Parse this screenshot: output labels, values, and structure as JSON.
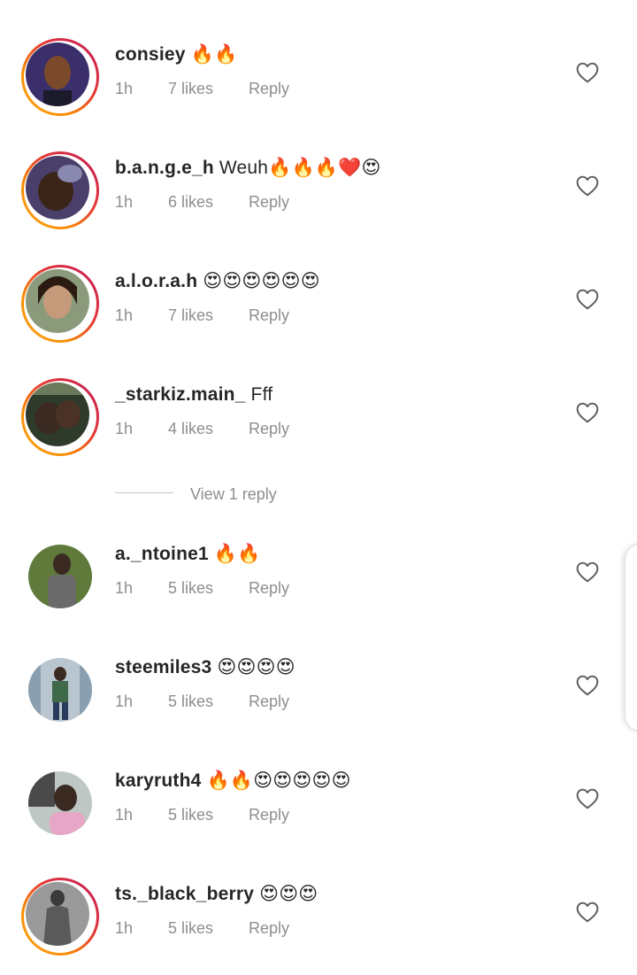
{
  "comments": [
    {
      "username": "consiey",
      "text": "🔥🔥",
      "time": "1h",
      "likes": "7 likes",
      "reply": "Reply",
      "story_ring": true,
      "avatar_bg": "#3a2f6b",
      "avatar_fg": "#7a4a2a"
    },
    {
      "username": "b.a.n.g.e_h",
      "text": "Weuh🔥🔥🔥❤️😍",
      "time": "1h",
      "likes": "6 likes",
      "reply": "Reply",
      "story_ring": true,
      "avatar_bg": "#4a3f6a",
      "avatar_fg": "#3b2418"
    },
    {
      "username": "a.l.o.r.a.h",
      "text": "😍😍😍😍😍😍",
      "time": "1h",
      "likes": "7 likes",
      "reply": "Reply",
      "story_ring": true,
      "avatar_bg": "#8a9a7a",
      "avatar_fg": "#c59a7a"
    },
    {
      "username": "_starkiz.main_",
      "text": "Fff",
      "time": "1h",
      "likes": "4 likes",
      "reply": "Reply",
      "story_ring": true,
      "avatar_bg": "#2e3a2a",
      "avatar_fg": "#3a2a22"
    },
    {
      "username": "a._ntoine1",
      "text": "🔥🔥",
      "time": "1h",
      "likes": "5 likes",
      "reply": "Reply",
      "story_ring": false,
      "avatar_bg": "#5f7a3a",
      "avatar_fg": "#6a6a6a"
    },
    {
      "username": "steemiles3",
      "text": "😍😍😍😍",
      "time": "1h",
      "likes": "5 likes",
      "reply": "Reply",
      "story_ring": false,
      "avatar_bg": "#b9c6cf",
      "avatar_fg": "#3f6a4a"
    },
    {
      "username": "karyruth4",
      "text": "🔥🔥😍😍😍😍😍",
      "time": "1h",
      "likes": "5 likes",
      "reply": "Reply",
      "story_ring": false,
      "avatar_bg": "#bfc7c4",
      "avatar_fg": "#e6a6c6"
    },
    {
      "username": "ts._black_berry",
      "text": "😍😍😍",
      "time": "1h",
      "likes": "5 likes",
      "reply": "Reply",
      "story_ring": true,
      "avatar_bg": "#9a9a9a",
      "avatar_fg": "#5a5a5a"
    }
  ],
  "view_replies": {
    "label": "View 1 reply"
  },
  "colors": {
    "text": "#262626",
    "secondary": "#8e8e8e",
    "story_ring_start": "#f9a825",
    "story_ring_end": "#c2185b"
  },
  "icons": {
    "like": "heart-outline-icon"
  }
}
